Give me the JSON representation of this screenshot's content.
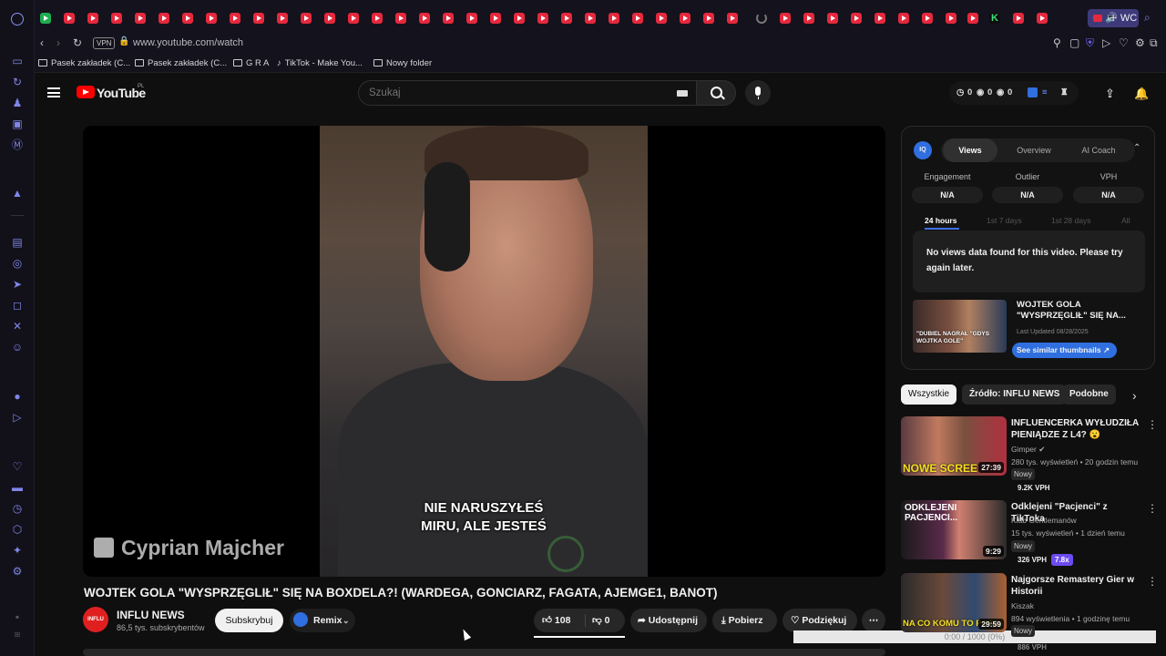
{
  "browser": {
    "active_tab_label": "WC",
    "url": "www.youtube.com/watch",
    "vpn_label": "VPN",
    "bookmarks": [
      "Pasek zakładek (C...",
      "Pasek zakładek (C...",
      "G R A",
      "TikTok - Make You...",
      "Nowy folder"
    ]
  },
  "header": {
    "logo_text": "YouTube",
    "logo_country": "PL",
    "search_placeholder": "Szukaj",
    "stats": [
      "0",
      "0",
      "0"
    ]
  },
  "player": {
    "subtitle_line1": "NIE NARUSZYŁEŚ",
    "subtitle_line2": "MIRU, ALE JESTEŚ",
    "watermark": "Cyprian Majcher"
  },
  "video": {
    "title": "WOJTEK GOLA \"WYSPRZĘGLIŁ\" SIĘ NA BOXDELA?! (WARDEGA, GONCIARZ, FAGATA, AJEMGE1, BANOT)",
    "channel_name": "INFLU NEWS",
    "channel_avatar_text": "INFLU",
    "subscribers": "86,5 tys. subskrybentów",
    "subscribe_label": "Subskrybuj",
    "remix_label": "Remix",
    "likes": "108",
    "dislikes": "0",
    "share_label": "Udostępnij",
    "download_label": "Pobierz",
    "thanks_label": "Podziękuj",
    "progress_text": "0:00 / 1000 (0%)"
  },
  "iq_panel": {
    "logo": "IQ",
    "tabs": [
      "Views",
      "Overview",
      "AI Coach"
    ],
    "metrics": [
      {
        "label": "Engagement",
        "value": "N/A"
      },
      {
        "label": "Outlier",
        "value": "N/A"
      },
      {
        "label": "VPH",
        "value": "N/A"
      }
    ],
    "ranges": [
      "24 hours",
      "1st 7 days",
      "1st 28 days",
      "All"
    ],
    "no_data": "No views data found for this video. Please try again later.",
    "thumb_caption": "\"DUBIEL NAGRAŁ \"GDYS WOJTKA GOLE\"",
    "mini_title": "WOJTEK GOLA \"WYSPRZĘGLIŁ\" SIĘ NA...",
    "last_updated": "Last Updated 08/28/2025",
    "similar_btn": "See similar thumbnails ↗"
  },
  "chips": [
    "Wszystkie",
    "Źródło: INFLU NEWS",
    "Podobne"
  ],
  "recommendations": [
    {
      "title": "INFLUENCERKA WYŁUDZIŁA PIENIĄDZE Z L4? 😮",
      "channel": "Gimper ✔",
      "meta": "280 tys. wyświetleń • 20 godzin temu",
      "badge": "Nowy",
      "vph": "9.2K VPH",
      "duration": "27:39",
      "thumb_text": "NOWE SCREE",
      "vph_color": "#272727",
      "vph2": ""
    },
    {
      "title": "Odklejeni \"Pacjenci\" z TikToka",
      "channel": "Klub Gentlemanów",
      "meta": "15 tys. wyświetleń • 1 dzień temu",
      "badge": "Nowy",
      "vph": "326 VPH",
      "duration": "9:29",
      "thumb_text": "ODKLEJENI PACJENCI...",
      "vph_color": "#272727",
      "vph2": "7.8x"
    },
    {
      "title": "Najgorsze Remastery Gier w Historii",
      "channel": "Kiszak",
      "meta": "894 wyświetlenia • 1 godzinę temu",
      "badge": "Nowy",
      "vph": "886 VPH",
      "duration": "29:59",
      "thumb_text": "NA CO KOMU TO POTE",
      "vph_color": "#272727",
      "vph2": ""
    }
  ],
  "colors": {
    "accent": "#ff0000",
    "iq_blue": "#2f6fe0",
    "vph_purple": "#6c4cf0"
  }
}
